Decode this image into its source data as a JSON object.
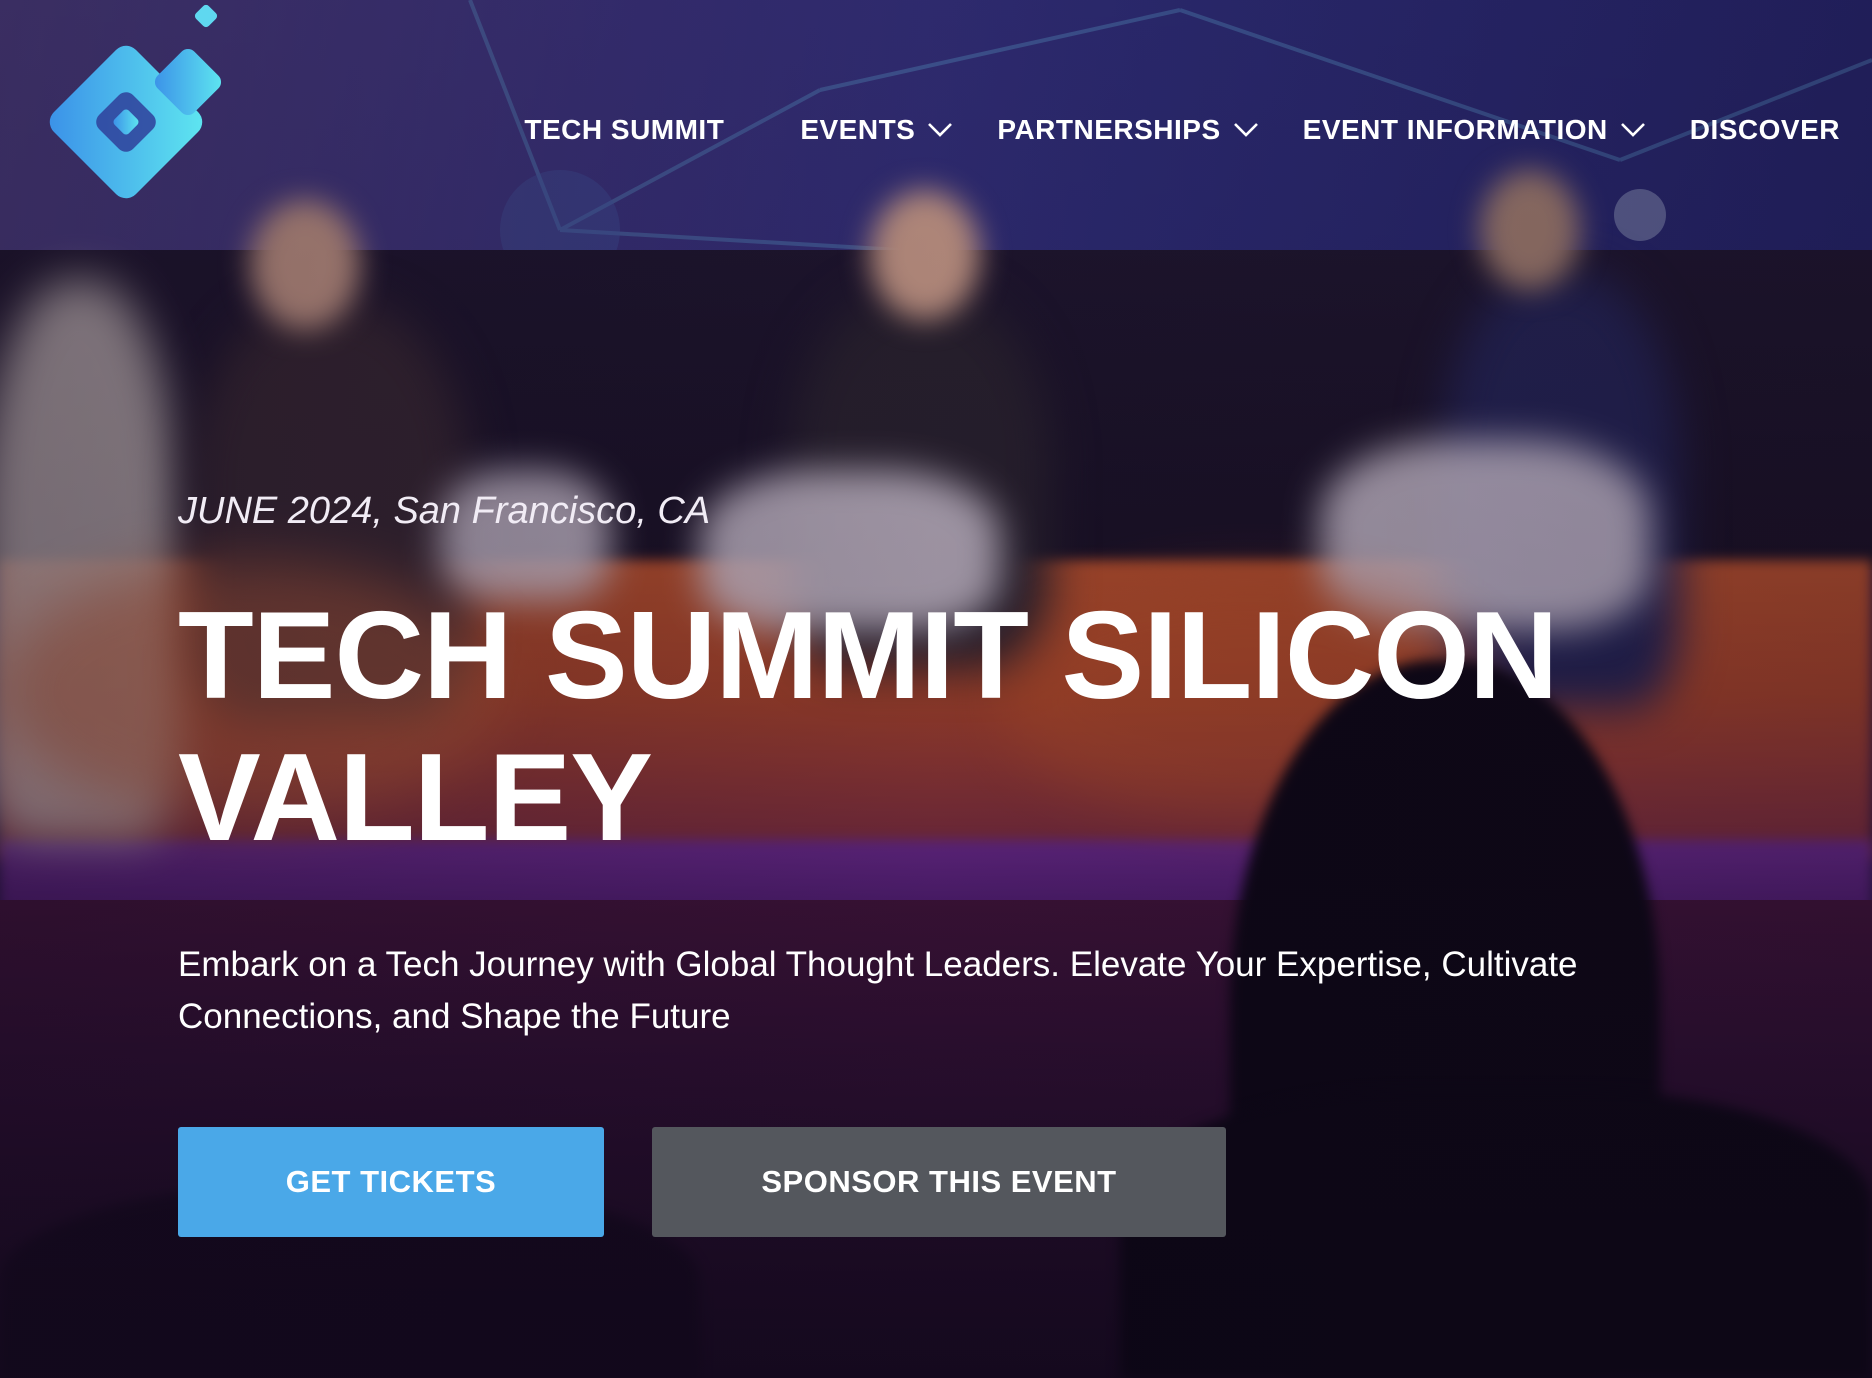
{
  "header": {
    "logo_icon": "brand-logo-icon",
    "nav": [
      {
        "label": "TECH SUMMIT",
        "has_dropdown": false
      },
      {
        "label": "EVENTS",
        "has_dropdown": true
      },
      {
        "label": "PARTNERSHIPS",
        "has_dropdown": true
      },
      {
        "label": "EVENT INFORMATION",
        "has_dropdown": true
      },
      {
        "label": "DISCOVER",
        "has_dropdown": false
      }
    ]
  },
  "hero": {
    "date_location": "JUNE 2024, San Francisco, CA",
    "title": "TECH SUMMIT SILICON VALLEY",
    "subtitle": "Embark on a Tech Journey with Global Thought Leaders. Elevate Your Expertise, Cultivate Connections, and Shape the Future",
    "primary_button": "GET TICKETS",
    "secondary_button": "SPONSOR THIS EVENT"
  },
  "colors": {
    "primary_button": "#4aa8e8",
    "secondary_button": "#54575d",
    "logo_gradient_start": "#3a8fe8",
    "logo_gradient_end": "#5fe8f0"
  }
}
